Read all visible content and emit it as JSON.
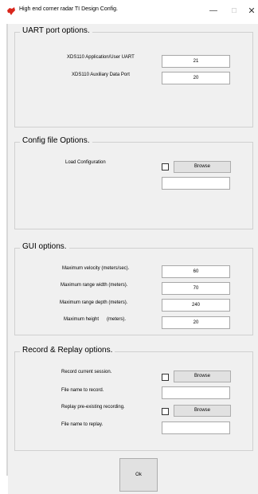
{
  "window": {
    "title": "High end corner radar TI Design Config.",
    "minimize": "—",
    "maximize": "☐",
    "close": "✕"
  },
  "uart": {
    "title": "UART port options.",
    "app_port_label": "XDS110 Application/User UART",
    "app_port_value": "21",
    "aux_port_label": "XDS110 Auxiliary Data Port",
    "aux_port_value": "20"
  },
  "config": {
    "title": "Config file Options.",
    "load_label": "Load Configuration",
    "browse_label": "Browse",
    "load_checked": false,
    "path_value": ""
  },
  "gui": {
    "title": "GUI options.",
    "velocity_label": "Maximum velocity (meters/sec).",
    "velocity_value": "60",
    "range_width_label": "Maximum range width (meters).",
    "range_width_value": "70",
    "range_depth_label": "Maximum range depth (meters).",
    "range_depth_value": "240",
    "height_label": "Maximum height      (meters).",
    "height_value": "20"
  },
  "record": {
    "title": "Record & Replay options.",
    "record_label": "Record current session.",
    "record_browse": "Browse",
    "record_checked": false,
    "record_file_label": "File name to record.",
    "record_file_value": "",
    "replay_label": "Replay pre-existing recording.",
    "replay_browse": "Browse",
    "replay_checked": false,
    "replay_file_label": "File name to replay.",
    "replay_file_value": ""
  },
  "ok_label": "Ok",
  "colors": {
    "window_bg": "#f0f0f0",
    "group_border": "#d0d0d0",
    "button_bg": "#e1e1e1",
    "icon_red": "#d9261c"
  }
}
